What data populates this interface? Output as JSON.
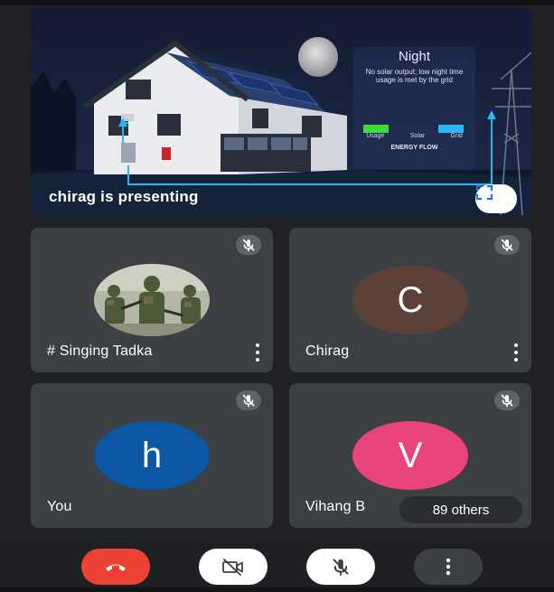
{
  "presentation": {
    "label": "chirag is presenting",
    "slide": {
      "title": "Night",
      "description": "No solar output; low night time usage is met by the grid",
      "flow_keys": [
        "Usage",
        "Solar",
        "Grid"
      ],
      "flow_title": "ENERGY FLOW"
    },
    "fullscreen_icon": "fullscreen-icon"
  },
  "participants": [
    {
      "name": "# Singing Tadka",
      "avatar_type": "photo",
      "muted": true,
      "has_menu": true
    },
    {
      "name": "Chirag",
      "initial": "C",
      "avatar_color": "#5d4037",
      "muted": true,
      "has_menu": true
    },
    {
      "name": "You",
      "initial": "h",
      "avatar_color": "#0b57a4",
      "muted": true,
      "has_menu": false
    },
    {
      "name": "Vihang B",
      "initial": "V",
      "avatar_color": "#e8437a",
      "muted": true,
      "has_menu": false,
      "others_label": "89 others"
    }
  ],
  "controls": {
    "end_call": {
      "icon": "phone-hangup-icon",
      "color": "#ea4335"
    },
    "camera": {
      "icon": "camera-off-icon"
    },
    "mic": {
      "icon": "mic-off-icon"
    },
    "more": {
      "icon": "more-vertical-icon"
    }
  }
}
